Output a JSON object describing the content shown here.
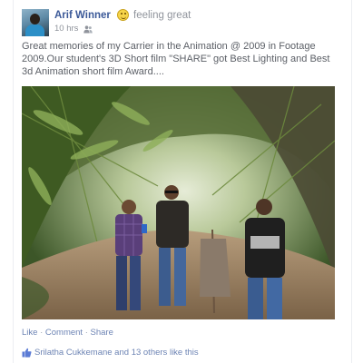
{
  "post": {
    "author": "Arif Winner",
    "feeling": "feeling great",
    "time": "10 hrs",
    "separator": "·",
    "caption": "Great memories  of my Carrier in the  Animation @ 2009 in Footage 2009.Our student's  3D Short film \"SHARE\" got Best Lighting and  Best 3d Animation short film  Award....",
    "photo_alt": "Four men standing on a path under a bamboo canopy"
  },
  "actions": {
    "like": "Like",
    "comment": "Comment",
    "share": "Share",
    "separator": " · "
  },
  "likes": {
    "name": "Srilatha Cukkemane",
    "connector": " and ",
    "others": "13 others",
    "suffix": " like this"
  },
  "colors": {
    "link": "#3b5998",
    "muted": "#90949c",
    "action_link": "#6d84b4"
  },
  "icons": {
    "feeling": "smiley-icon",
    "audience": "friends-icon",
    "like": "thumbs-up-icon"
  }
}
